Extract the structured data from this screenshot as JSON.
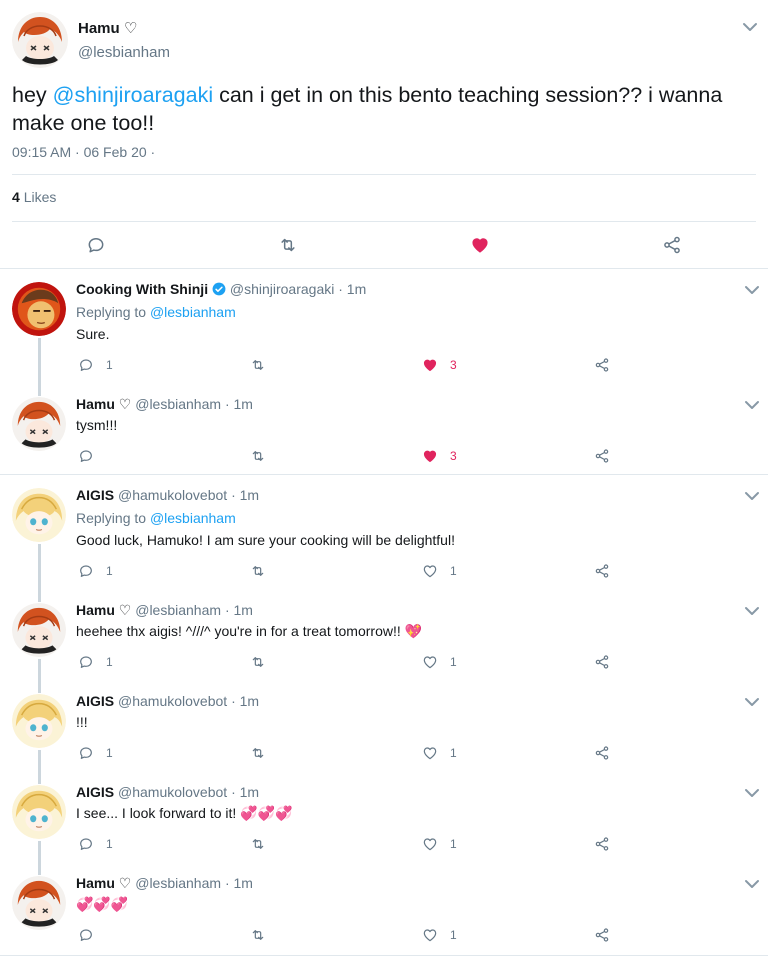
{
  "main_tweet": {
    "name": "Hamu ♡",
    "handle": "@lesbianham",
    "text_before": "hey ",
    "mention": "@shinjiroaragaki",
    "text_after": " can i get in on this bento teaching session?? i wanna make one too!!",
    "timestamp": "09:15 AM · 06 Feb 20 ·",
    "likes_count": "4",
    "likes_label": "Likes",
    "liked": true
  },
  "colors": {
    "link": "#1da1f2",
    "like": "#e0245e",
    "muted": "#657786",
    "verified": "#1da1f2"
  },
  "replies": [
    {
      "name": "Cooking With Shinji",
      "verified": true,
      "handle": "@shinjiroaragaki",
      "time": "· 1m",
      "replying_prefix": "Replying to",
      "replying_to": "@lesbianham",
      "text": "Sure.",
      "reply_count": "1",
      "like_count": "3",
      "liked": true,
      "avatar": "shinji-avatar"
    },
    {
      "name": "Hamu ♡",
      "verified": false,
      "handle": "@lesbianham",
      "time": "· 1m",
      "text": "tysm!!!",
      "reply_count": "",
      "like_count": "3",
      "liked": true,
      "avatar": "hamu-avatar"
    },
    {
      "name": "AIGIS",
      "verified": false,
      "handle": "@hamukolovebot",
      "time": "· 1m",
      "replying_prefix": "Replying to",
      "replying_to": "@lesbianham",
      "text": "Good luck, Hamuko! I am sure your cooking will be delightful!",
      "reply_count": "1",
      "like_count": "1",
      "liked": false,
      "avatar": "aigis-avatar"
    },
    {
      "name": "Hamu ♡",
      "verified": false,
      "handle": "@lesbianham",
      "time": "· 1m",
      "text": "heehee thx aigis! ^///^ you're in for a treat tomorrow!! 💖",
      "reply_count": "1",
      "like_count": "1",
      "liked": false,
      "avatar": "hamu-avatar"
    },
    {
      "name": "AIGIS",
      "verified": false,
      "handle": "@hamukolovebot",
      "time": "· 1m",
      "text": "!!!",
      "reply_count": "1",
      "like_count": "1",
      "liked": false,
      "avatar": "aigis-avatar"
    },
    {
      "name": "AIGIS",
      "verified": false,
      "handle": "@hamukolovebot",
      "time": "· 1m",
      "text": "I see... I look forward to it! 💞💞💞",
      "reply_count": "1",
      "like_count": "1",
      "liked": false,
      "avatar": "aigis-avatar"
    },
    {
      "name": "Hamu ♡",
      "verified": false,
      "handle": "@lesbianham",
      "time": "· 1m",
      "text": "💞💞💞",
      "reply_count": "",
      "like_count": "1",
      "liked": false,
      "avatar": "hamu-avatar"
    }
  ]
}
